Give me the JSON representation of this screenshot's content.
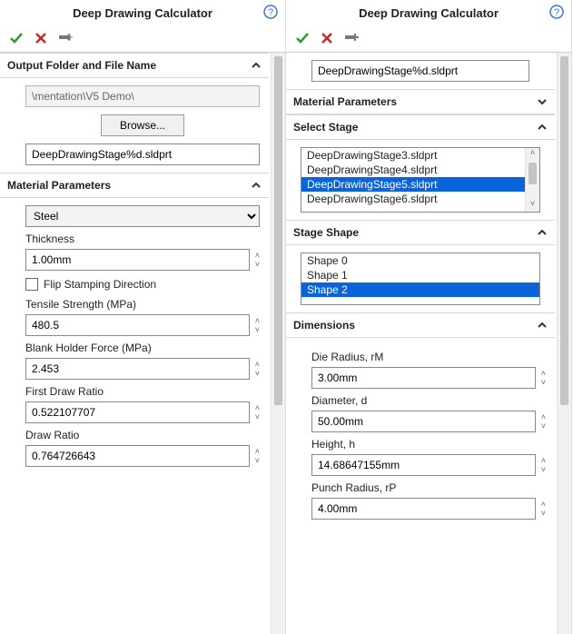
{
  "leftPanel": {
    "title": "Deep Drawing Calculator",
    "sections": {
      "output": {
        "header": "Output Folder and File Name",
        "expanded": true,
        "folderPath": "\\mentation\\V5 Demo\\",
        "browseLabel": "Browse...",
        "fileName": "DeepDrawingStage%d.sldprt"
      },
      "material": {
        "header": "Material Parameters",
        "expanded": true,
        "materialOptions": [
          "Steel"
        ],
        "materialSelected": "Steel",
        "thicknessLabel": "Thickness",
        "thicknessValue": "1.00mm",
        "flipLabel": "Flip Stamping Direction",
        "flipChecked": false,
        "tensileLabel": "Tensile Strength (MPa)",
        "tensileValue": "480.5",
        "blankHolderLabel": "Blank Holder Force (MPa)",
        "blankHolderValue": "2.453",
        "firstDrawLabel": "First Draw Ratio",
        "firstDrawValue": "0.522107707",
        "drawRatioLabel": "Draw Ratio",
        "drawRatioValue": "0.764726643"
      }
    }
  },
  "rightPanel": {
    "title": "Deep Drawing Calculator",
    "fileName": "DeepDrawingStage%d.sldprt",
    "sections": {
      "material": {
        "header": "Material Parameters",
        "expanded": false
      },
      "selectStage": {
        "header": "Select Stage",
        "expanded": true,
        "items": [
          "DeepDrawingStage3.sldprt",
          "DeepDrawingStage4.sldprt",
          "DeepDrawingStage5.sldprt",
          "DeepDrawingStage6.sldprt"
        ],
        "selectedIndex": 2
      },
      "stageShape": {
        "header": "Stage Shape",
        "expanded": true,
        "items": [
          "Shape 0",
          "Shape 1",
          "Shape 2"
        ],
        "selectedIndex": 2
      },
      "dimensions": {
        "header": "Dimensions",
        "expanded": true,
        "dieRadiusLabel": "Die Radius, rM",
        "dieRadiusValue": "3.00mm",
        "diameterLabel": "Diameter, d",
        "diameterValue": "50.00mm",
        "heightLabel": "Height, h",
        "heightValue": "14.68647155mm",
        "punchRadiusLabel": "Punch Radius, rP",
        "punchRadiusValue": "4.00mm"
      }
    }
  }
}
